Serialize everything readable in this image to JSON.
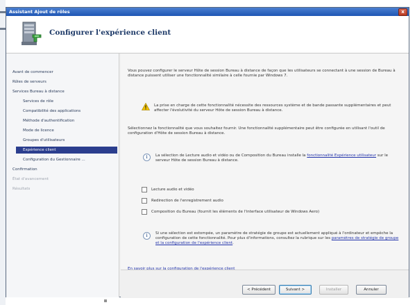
{
  "window": {
    "title": "Assistant Ajout de rôles",
    "close_label": "x"
  },
  "header": {
    "title": "Configurer l'expérience client",
    "icon": "server-roles-wizard-icon"
  },
  "nav": {
    "items": [
      {
        "label": "Avant de commencer",
        "state": "normal"
      },
      {
        "label": "Rôles de serveurs",
        "state": "normal"
      },
      {
        "label": "Services Bureau à distance",
        "state": "normal"
      },
      {
        "label": "Services de rôle",
        "state": "normal"
      },
      {
        "label": "Compatibilité des applications",
        "state": "normal"
      },
      {
        "label": "Méthode d'authentification",
        "state": "normal"
      },
      {
        "label": "Mode de licence",
        "state": "normal"
      },
      {
        "label": "Groupes d'utilisateurs",
        "state": "normal"
      },
      {
        "label": "Expérience client",
        "state": "selected"
      },
      {
        "label": "Configuration du Gestionnaire ...",
        "state": "normal"
      },
      {
        "label": "Confirmation",
        "state": "normal"
      },
      {
        "label": "État d'avancement",
        "state": "disabled"
      },
      {
        "label": "Résultats",
        "state": "disabled"
      }
    ]
  },
  "content": {
    "intro": "Vous pouvez configurer le serveur Hôte de session Bureau à distance de façon que les utilisateurs se connectant à une session de Bureau à distance puissent utiliser une fonctionnalité similaire à celle fournie par Windows 7.",
    "warning": "La prise en charge de cette fonctionnalité nécessite des ressources système et de bande passante supplémentaires et peut affecter l'évolutivité du serveur Hôte de session Bureau à distance.",
    "select_text": "Sélectionnez la fonctionnalité que vous souhaitez fournir. Une fonctionnalité supplémentaire peut être configurée en utilisant l'outil de configuration d'Hôte de session Bureau à distance.",
    "info1_before": "La sélection de Lecture audio et vidéo ou de Composition du Bureau installe la ",
    "info1_link": "fonctionnalité Expérience utilisateur",
    "info1_after": " sur le serveur Hôte de session Bureau à distance.",
    "checkboxes": [
      {
        "label": "Lecture audio et vidéo",
        "checked": false
      },
      {
        "label": "Redirection de l'enregistrement audio",
        "checked": false
      },
      {
        "label": "Composition du Bureau (fournit les éléments de l'interface utilisateur de Windows Aero)",
        "checked": false
      }
    ],
    "info2_before": "Si une sélection est estompée, un paramètre de stratégie de groupe est actuellement appliqué à l'ordinateur et empêche la configuration de cette fonctionnalité. Pour plus d'informations, consultez la rubrique sur les ",
    "info2_link": "paramètres de stratégie de groupe et la configuration de l'expérience client",
    "info2_after": ".",
    "more_link": "En savoir plus sur la configuration de l'expérience client"
  },
  "footer": {
    "prev": "< Précédent",
    "next": "Suivant >",
    "install": "Installer",
    "cancel": "Annuler"
  },
  "colors": {
    "titlebar": "#1f56b4",
    "nav_selected": "#2b3e8e",
    "link": "#2233aa"
  }
}
